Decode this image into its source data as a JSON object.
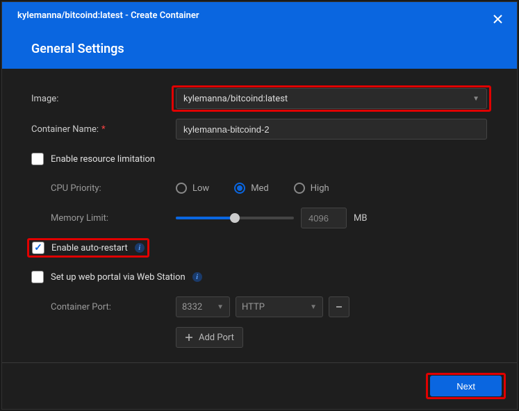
{
  "window_title": "kylemanna/bitcoind:latest - Create Container",
  "section_title": "General Settings",
  "labels": {
    "image": "Image:",
    "container_name": "Container Name:",
    "enable_resource": "Enable resource limitation",
    "cpu_priority": "CPU Priority:",
    "memory_limit": "Memory Limit:",
    "enable_restart": "Enable auto-restart",
    "web_portal": "Set up web portal via Web Station",
    "container_port": "Container Port:",
    "add_port": "Add Port",
    "mb": "MB"
  },
  "values": {
    "image": "kylemanna/bitcoind:latest",
    "container_name": "kylemanna-bitcoind-2",
    "memory": "4096",
    "port": "8332",
    "protocol": "HTTP"
  },
  "radios": {
    "low": "Low",
    "med": "Med",
    "high": "High"
  },
  "buttons": {
    "next": "Next"
  }
}
